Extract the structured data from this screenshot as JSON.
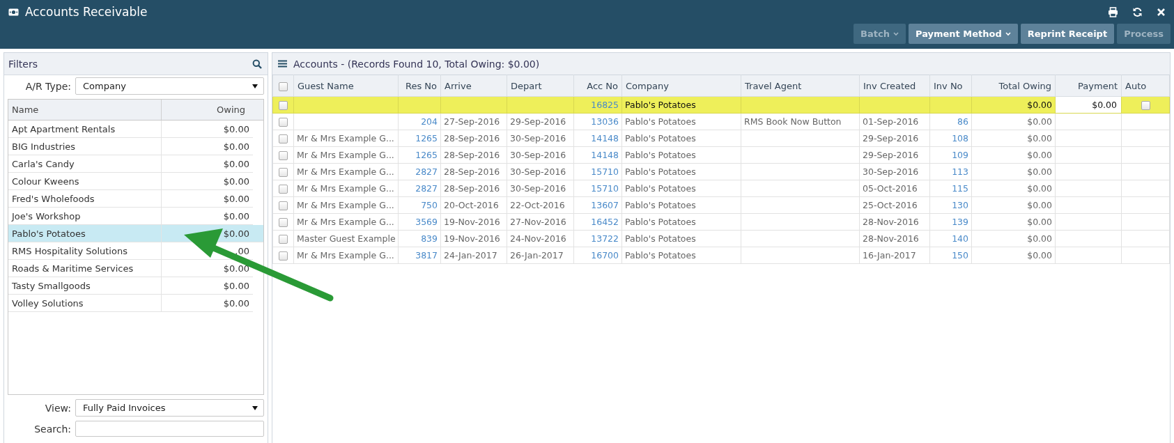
{
  "window": {
    "title": "Accounts Receivable"
  },
  "toolbar": [
    {
      "label": "Batch",
      "dropdown": true,
      "disabled": true
    },
    {
      "label": "Payment Method",
      "dropdown": true,
      "disabled": false
    },
    {
      "label": "Reprint Receipt",
      "dropdown": false,
      "disabled": false
    },
    {
      "label": "Process",
      "dropdown": false,
      "disabled": true
    }
  ],
  "filters": {
    "title": "Filters",
    "ar_type_label": "A/R Type:",
    "ar_type": "Company",
    "columns": [
      "Name",
      "Owing"
    ],
    "items": [
      {
        "name": "Apt Apartment Rentals",
        "owing": "$0.00",
        "selected": false
      },
      {
        "name": "BIG Industries",
        "owing": "$0.00",
        "selected": false
      },
      {
        "name": "Carla's Candy",
        "owing": "$0.00",
        "selected": false
      },
      {
        "name": "Colour Kweens",
        "owing": "$0.00",
        "selected": false
      },
      {
        "name": "Fred's Wholefoods",
        "owing": "$0.00",
        "selected": false
      },
      {
        "name": "Joe's Workshop",
        "owing": "$0.00",
        "selected": false
      },
      {
        "name": "Pablo's Potatoes",
        "owing": "$0.00",
        "selected": true
      },
      {
        "name": "RMS Hospitality Solutions",
        "owing": ".00",
        "selected": false
      },
      {
        "name": "Roads & Maritime Services",
        "owing": "$0.00",
        "selected": false
      },
      {
        "name": "Tasty Smallgoods",
        "owing": "$0.00",
        "selected": false
      },
      {
        "name": "Volley Solutions",
        "owing": "$0.00",
        "selected": false
      }
    ],
    "view_label": "View:",
    "view": "Fully Paid Invoices",
    "search_label": "Search:"
  },
  "accounts": {
    "title": "Accounts - (Records Found 10, Total Owing: $0.00)",
    "select_all": false,
    "columns": [
      "Guest Name",
      "Res No",
      "Arrive",
      "Depart",
      "Acc No",
      "Company",
      "Travel Agent",
      "Inv Created",
      "Inv No",
      "Total Owing",
      "Payment",
      "Auto"
    ],
    "rows": [
      {
        "highlighted": true,
        "checked": false,
        "guest": "",
        "res": "",
        "arrive": "",
        "depart": "",
        "acc": "16825",
        "company": "Pablo's Potatoes",
        "agent": "",
        "created": "",
        "inv": "",
        "owing": "$0.00",
        "payment": "$0.00",
        "auto": false
      },
      {
        "highlighted": false,
        "checked": false,
        "guest": "",
        "res": "204",
        "arrive": "27-Sep-2016",
        "depart": "29-Sep-2016",
        "acc": "13036",
        "company": "Pablo's Potatoes",
        "agent": "RMS Book Now Button",
        "created": "01-Sep-2016",
        "inv": "86",
        "owing": "$0.00"
      },
      {
        "highlighted": false,
        "checked": false,
        "guest": "Mr & Mrs Example G...",
        "res": "1265",
        "arrive": "28-Sep-2016",
        "depart": "30-Sep-2016",
        "acc": "14148",
        "company": "Pablo's Potatoes",
        "agent": "",
        "created": "29-Sep-2016",
        "inv": "108",
        "owing": "$0.00"
      },
      {
        "highlighted": false,
        "checked": false,
        "guest": "Mr & Mrs Example G...",
        "res": "1265",
        "arrive": "28-Sep-2016",
        "depart": "30-Sep-2016",
        "acc": "14148",
        "company": "Pablo's Potatoes",
        "agent": "",
        "created": "29-Sep-2016",
        "inv": "109",
        "owing": "$0.00"
      },
      {
        "highlighted": false,
        "checked": false,
        "guest": "Mr & Mrs Example G...",
        "res": "2827",
        "arrive": "28-Sep-2016",
        "depart": "30-Sep-2016",
        "acc": "15710",
        "company": "Pablo's Potatoes",
        "agent": "",
        "created": "30-Sep-2016",
        "inv": "113",
        "owing": "$0.00"
      },
      {
        "highlighted": false,
        "checked": false,
        "guest": "Mr & Mrs Example G...",
        "res": "2827",
        "arrive": "28-Sep-2016",
        "depart": "30-Sep-2016",
        "acc": "15710",
        "company": "Pablo's Potatoes",
        "agent": "",
        "created": "05-Oct-2016",
        "inv": "115",
        "owing": "$0.00"
      },
      {
        "highlighted": false,
        "checked": false,
        "guest": "Mr & Mrs Example G...",
        "res": "750",
        "arrive": "20-Oct-2016",
        "depart": "22-Oct-2016",
        "acc": "13607",
        "company": "Pablo's Potatoes",
        "agent": "",
        "created": "25-Oct-2016",
        "inv": "130",
        "owing": "$0.00"
      },
      {
        "highlighted": false,
        "checked": false,
        "guest": "Mr & Mrs Example G...",
        "res": "3569",
        "arrive": "19-Nov-2016",
        "depart": "27-Nov-2016",
        "acc": "16452",
        "company": "Pablo's Potatoes",
        "agent": "",
        "created": "28-Nov-2016",
        "inv": "139",
        "owing": "$0.00"
      },
      {
        "highlighted": false,
        "checked": false,
        "guest": "Master Guest Example",
        "res": "839",
        "arrive": "19-Nov-2016",
        "depart": "24-Nov-2016",
        "acc": "13722",
        "company": "Pablo's Potatoes",
        "agent": "",
        "created": "28-Nov-2016",
        "inv": "140",
        "owing": "$0.00"
      },
      {
        "highlighted": false,
        "checked": false,
        "guest": "Mr & Mrs Example G...",
        "res": "3817",
        "arrive": "24-Jan-2017",
        "depart": "26-Jan-2017",
        "acc": "16700",
        "company": "Pablo's Potatoes",
        "agent": "",
        "created": "16-Jan-2017",
        "inv": "150",
        "owing": "$0.00"
      }
    ]
  }
}
